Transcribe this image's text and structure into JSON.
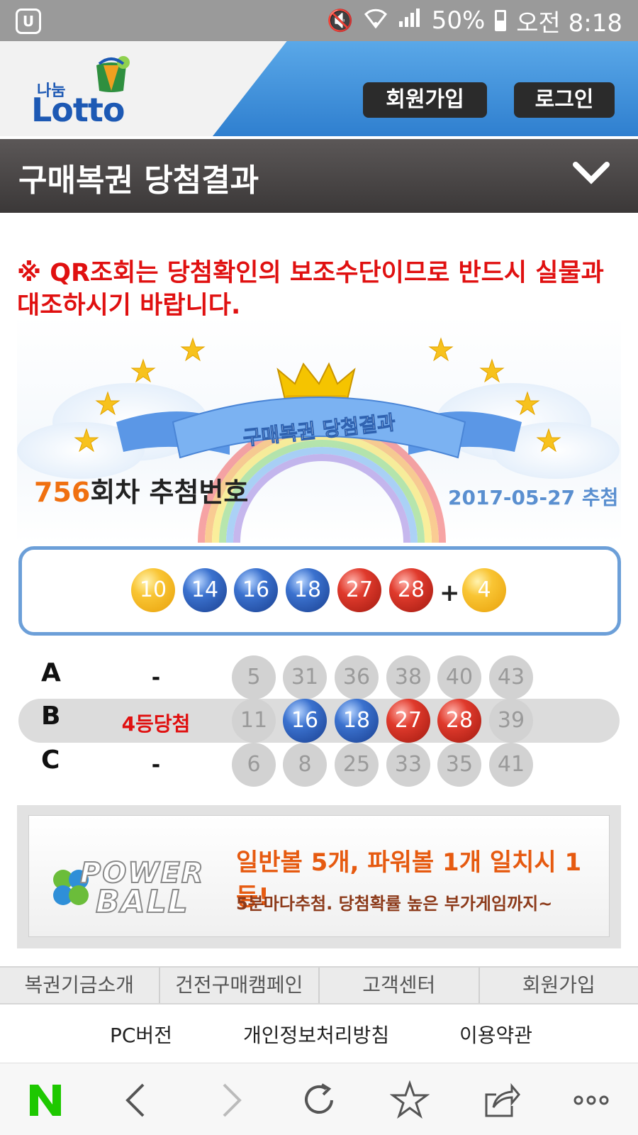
{
  "status_bar": {
    "battery": "50%",
    "time": "오전 8:18"
  },
  "header": {
    "logo_small": "나눔",
    "logo_big": "Lotto",
    "join_button": "회원가입",
    "login_button": "로그인"
  },
  "title_bar": {
    "title": "구매복권 당첨결과"
  },
  "notice": "※ QR조회는 당첨확인의 보조수단이므로 반드시 실물과 대조하시기 바랍니다.",
  "banner": {
    "ribbon_text": "구매복권 당첨결과",
    "round_number": "756",
    "round_suffix": "회차 추첨번호",
    "draw_date": "2017-05-27 추첨"
  },
  "winning": {
    "numbers": [
      "10",
      "14",
      "16",
      "18",
      "27",
      "28"
    ],
    "plus": "+",
    "bonus": "4"
  },
  "tickets": [
    {
      "label": "A",
      "result": "-",
      "numbers": [
        "5",
        "31",
        "36",
        "38",
        "40",
        "43"
      ],
      "matched": []
    },
    {
      "label": "B",
      "result": "4등당첨",
      "numbers": [
        "11",
        "16",
        "18",
        "27",
        "28",
        "39"
      ],
      "matched": [
        "16",
        "18",
        "27",
        "28"
      ]
    },
    {
      "label": "C",
      "result": "-",
      "numbers": [
        "6",
        "8",
        "25",
        "33",
        "35",
        "41"
      ],
      "matched": []
    }
  ],
  "ad": {
    "logo_line1": "POWER",
    "logo_line2": "BALL",
    "headline": "일반볼 5개, 파워볼 1개 일치시 1등!",
    "subline": "5분마다추첨. 당첨확률 높은 부가게임까지~"
  },
  "footer_nav": [
    "복권기금소개",
    "건전구매캠페인",
    "고객센터",
    "회원가입"
  ],
  "footer_links": [
    "PC버전",
    "개인정보처리방침",
    "이용약관"
  ],
  "browser_bar": [
    "n-home-icon",
    "back-icon",
    "forward-icon",
    "reload-icon",
    "bookmark-star-icon",
    "share-icon",
    "more-icon"
  ]
}
